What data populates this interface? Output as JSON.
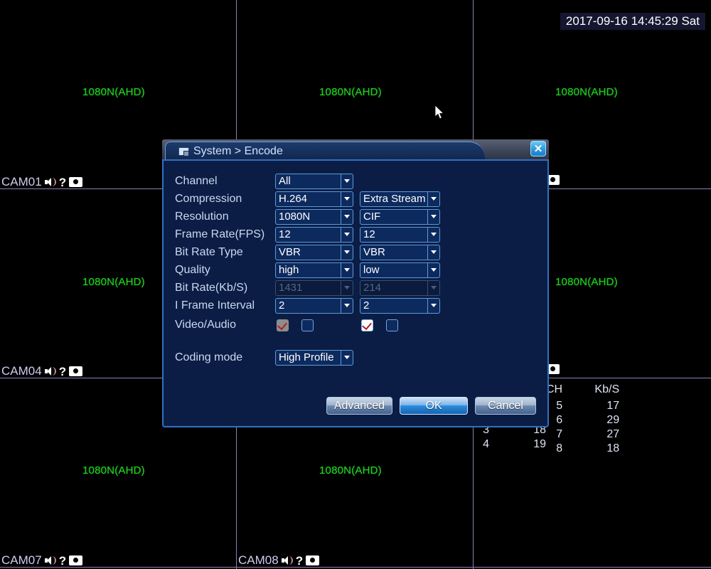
{
  "live_view": {
    "timestamp": "2017-09-16 14:45:29 Sat",
    "resolution_label": "1080N(AHD)",
    "cells": [
      {
        "resolution": "1080N(AHD)"
      },
      {
        "resolution": "1080N(AHD)"
      },
      {
        "resolution": "1080N(AHD)"
      },
      {
        "resolution": "1080N(AHD)"
      },
      {
        "resolution": "1080N(AHD)"
      },
      {
        "resolution": "1080N(AHD)"
      },
      {
        "resolution": "1080N(AHD)"
      },
      {
        "resolution": "1080N(AHD)"
      },
      {
        "resolution": "1080N(AHD)"
      }
    ],
    "cameras": [
      {
        "name": "CAM01"
      },
      {
        "name": "CAM04"
      },
      {
        "name": "CAM07"
      },
      {
        "name": "CAM08"
      }
    ],
    "grid_line_color": "#8f7fb8",
    "resolution_color": "#22cc22"
  },
  "stats": {
    "headers": {
      "ch": "CH",
      "rate": "Kb/S"
    },
    "rows": [
      {
        "ch": "5",
        "rate": "17"
      },
      {
        "ch": "6",
        "rate": "29"
      },
      {
        "ch": "7",
        "rate": "27"
      },
      {
        "ch": "8",
        "rate": "18"
      }
    ],
    "partial_rows": [
      {
        "ch": "3",
        "rate": "18"
      },
      {
        "ch": "4",
        "rate": "19"
      }
    ]
  },
  "dialog": {
    "title": "System > Encode",
    "close_label": "✕",
    "rows": [
      {
        "label": "Channel",
        "primary": {
          "value": "All",
          "disabled": false
        },
        "secondary": null
      },
      {
        "label": "Compression",
        "primary": {
          "value": "H.264",
          "disabled": false
        },
        "secondary": {
          "value": "Extra Stream",
          "disabled": false
        }
      },
      {
        "label": "Resolution",
        "primary": {
          "value": "1080N",
          "disabled": false
        },
        "secondary": {
          "value": "CIF",
          "disabled": false
        }
      },
      {
        "label": "Frame Rate(FPS)",
        "primary": {
          "value": "12",
          "disabled": false
        },
        "secondary": {
          "value": "12",
          "disabled": false
        }
      },
      {
        "label": "Bit Rate Type",
        "primary": {
          "value": "VBR",
          "disabled": false
        },
        "secondary": {
          "value": "VBR",
          "disabled": false
        }
      },
      {
        "label": "Quality",
        "primary": {
          "value": "high",
          "disabled": false
        },
        "secondary": {
          "value": "low",
          "disabled": false
        }
      },
      {
        "label": "Bit Rate(Kb/S)",
        "primary": {
          "value": "1431",
          "disabled": true
        },
        "secondary": {
          "value": "214",
          "disabled": true
        }
      },
      {
        "label": "I Frame Interval",
        "primary": {
          "value": "2",
          "disabled": false
        },
        "secondary": {
          "value": "2",
          "disabled": false
        }
      }
    ],
    "video_audio": {
      "label": "Video/Audio",
      "main_video_checked": true,
      "main_video_disabled": true,
      "main_audio_checked": false,
      "extra_video_checked": true,
      "extra_audio_checked": false
    },
    "coding_mode": {
      "label": "Coding mode",
      "value": "High Profile"
    },
    "buttons": {
      "advanced": "Advanced",
      "ok": "OK",
      "cancel": "Cancel"
    }
  }
}
